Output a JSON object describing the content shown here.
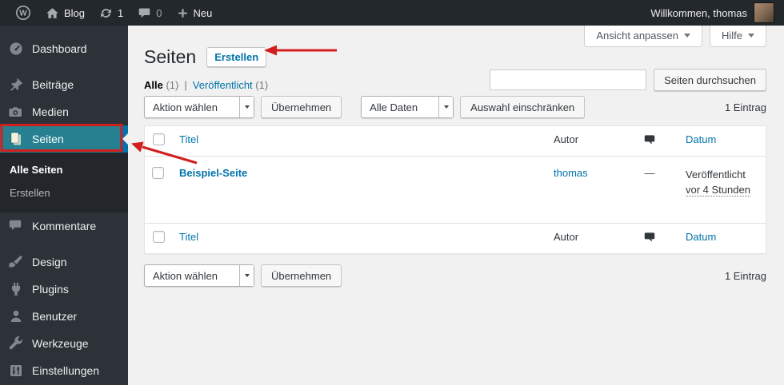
{
  "admin_bar": {
    "site_name": "Blog",
    "update_count": "1",
    "comment_count": "0",
    "new_label": "Neu",
    "welcome": "Willkommen, thomas"
  },
  "sidebar": {
    "items": [
      {
        "label": "Dashboard"
      },
      {
        "label": "Beiträge"
      },
      {
        "label": "Medien"
      },
      {
        "label": "Seiten"
      },
      {
        "label": "Kommentare"
      },
      {
        "label": "Design"
      },
      {
        "label": "Plugins"
      },
      {
        "label": "Benutzer"
      },
      {
        "label": "Werkzeuge"
      },
      {
        "label": "Einstellungen"
      }
    ],
    "submenu": {
      "all_pages": "Alle Seiten",
      "add_new": "Erstellen"
    }
  },
  "page": {
    "title": "Seiten",
    "add_new_label": "Erstellen",
    "screen_options_label": "Ansicht anpassen",
    "help_label": "Hilfe",
    "views": {
      "all_label": "Alle",
      "all_count": "(1)",
      "separator": "|",
      "published_label": "Veröffentlicht",
      "published_count": "(1)"
    },
    "search": {
      "value": "",
      "button_label": "Seiten durchsuchen"
    },
    "bulk_action_select": "Aktion wählen",
    "apply_button": "Übernehmen",
    "date_filter_select": "Alle Daten",
    "filter_button": "Auswahl einschränken",
    "items_count": "1 Eintrag"
  },
  "table": {
    "columns": {
      "title": "Titel",
      "author": "Autor",
      "date": "Datum"
    },
    "row": {
      "title": "Beispiel-Seite",
      "author": "thomas",
      "comments": "—",
      "date_status": "Veröffentlicht",
      "date_relative": "vor 4 Stunden"
    }
  },
  "colors": {
    "accent": "#0073aa",
    "active_menu_teal": "#26808f",
    "annotation_red": "#d21e1e",
    "admin_bar_bg": "#23282d"
  }
}
